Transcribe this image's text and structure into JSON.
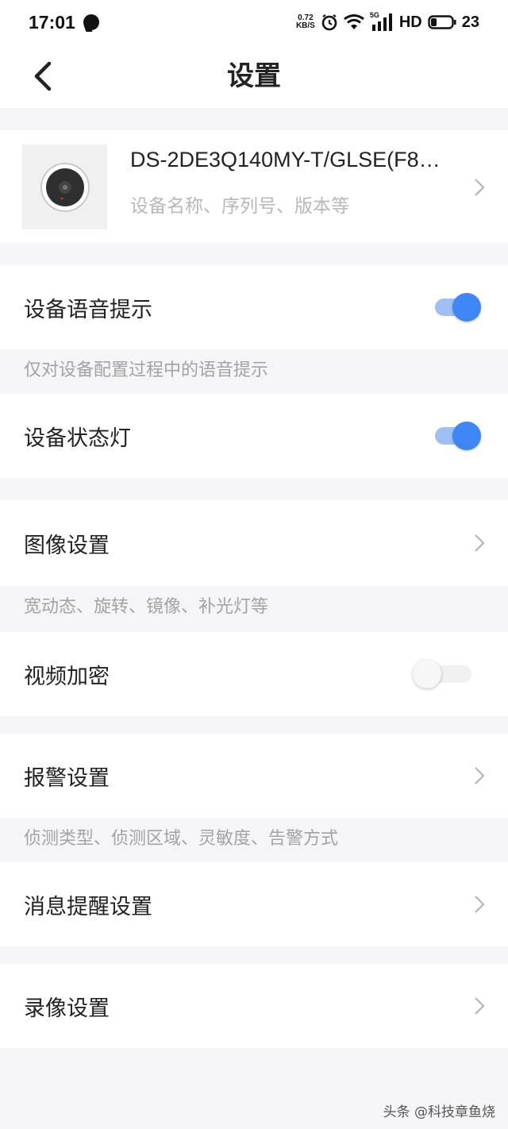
{
  "status_bar": {
    "time": "17:01",
    "net_speed_value": "0.72",
    "net_speed_unit": "KB/S",
    "network_type": "5G",
    "hd_label": "HD",
    "battery": "23"
  },
  "header": {
    "title": "设置",
    "back_icon": "chevron-left-icon"
  },
  "device": {
    "name": "DS-2DE3Q140MY-T/GLSE(F8…",
    "subtitle": "设备名称、序列号、版本等"
  },
  "settings": {
    "voice_prompt": {
      "label": "设备语音提示",
      "enabled": true
    },
    "voice_prompt_hint": "仅对设备配置过程中的语音提示",
    "status_light": {
      "label": "设备状态灯",
      "enabled": true
    },
    "image_settings": {
      "label": "图像设置"
    },
    "image_settings_hint": "宽动态、旋转、镜像、补光灯等",
    "video_encryption": {
      "label": "视频加密",
      "enabled": false
    },
    "alarm_settings": {
      "label": "报警设置"
    },
    "alarm_settings_hint": "侦测类型、侦测区域、灵敏度、告警方式",
    "message_settings": {
      "label": "消息提醒设置"
    },
    "recording_settings": {
      "label": "录像设置"
    }
  },
  "watermark": "头条 @科技章鱼烧",
  "colors": {
    "accent": "#3d86f3",
    "background": "#f5f5f7",
    "hint_text": "#a3a3a3"
  }
}
